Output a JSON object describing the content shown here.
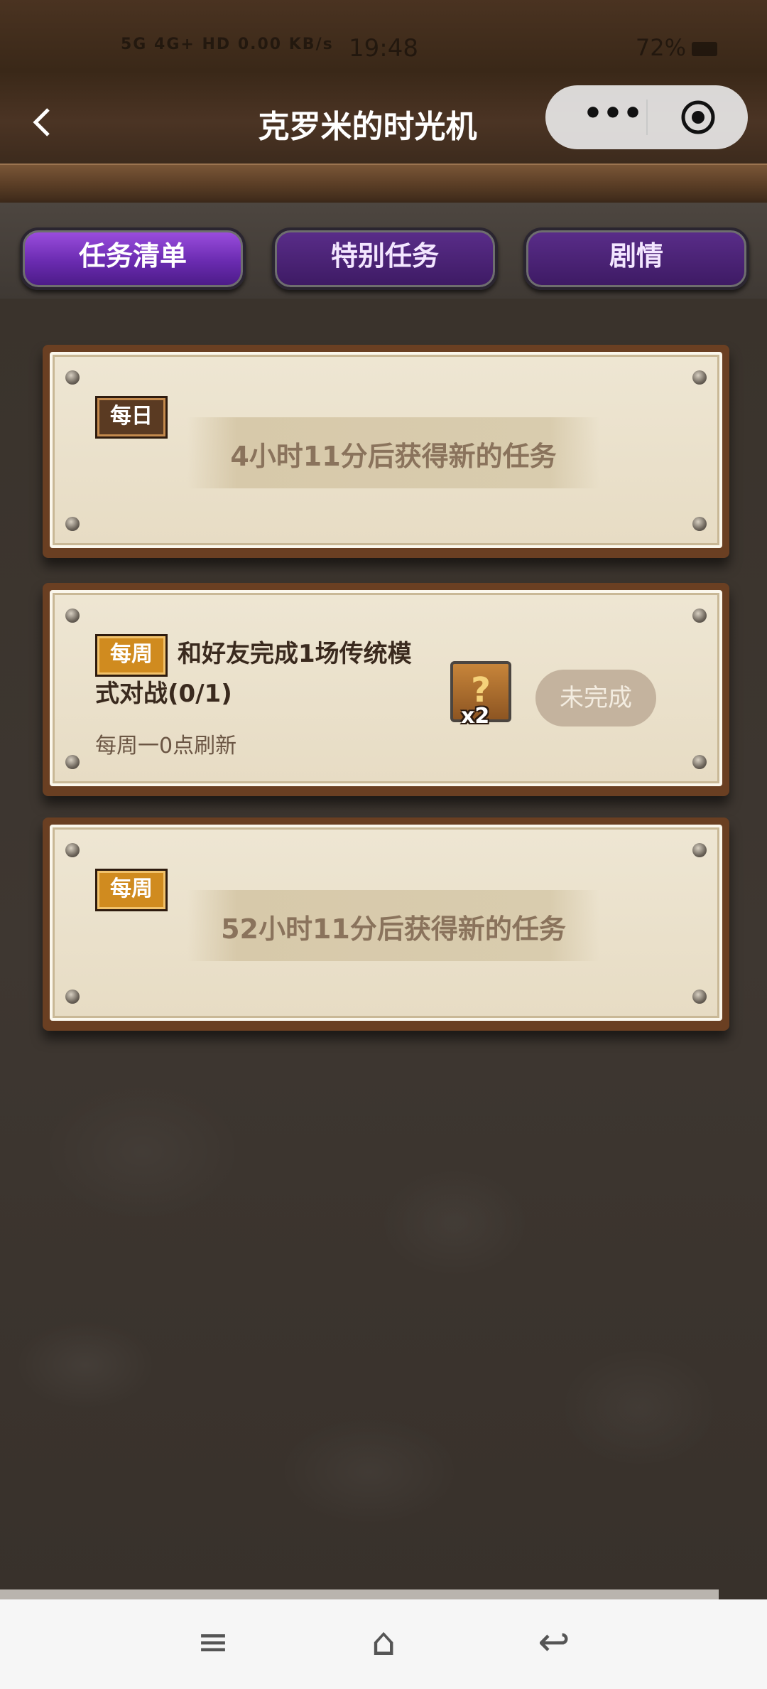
{
  "status_bar": {
    "network": "5G 4G+ HD 0.00 KB/s",
    "time": "19:48",
    "battery": "72%"
  },
  "header": {
    "title": "克罗米的时光机",
    "back_icon": "chevron-left-icon",
    "more_label": "•••"
  },
  "tabs": [
    {
      "label": "任务清单",
      "active": true
    },
    {
      "label": "特别任务",
      "active": false
    },
    {
      "label": "剧情",
      "active": false
    }
  ],
  "cards": [
    {
      "badge": "每日",
      "banner": "4小时11分后获得新的任务"
    },
    {
      "badge": "每周",
      "task_line1": "和好友完成1场传统模",
      "task_line2": "式对战(0/1)",
      "refresh": "每周一0点刷新",
      "reward_icon": "?",
      "reward_count": "x2",
      "status": "未完成"
    },
    {
      "badge": "每周",
      "banner": "52小时11分后获得新的任务"
    }
  ],
  "bottom_nav": {
    "menu_icon": "≡",
    "home_icon": "⌂",
    "back_icon": "↩"
  }
}
